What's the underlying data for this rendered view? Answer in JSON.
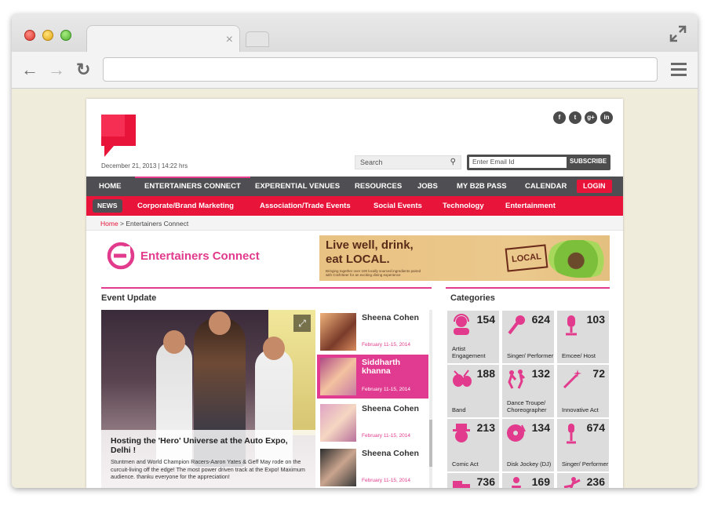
{
  "browser": {
    "tab_close": "×",
    "address_value": ""
  },
  "header": {
    "date": "December 21, 2013",
    "time": "14:22 hrs",
    "date_sep": "|",
    "social": [
      "f",
      "t",
      "g+",
      "in"
    ],
    "search_placeholder": "Search",
    "email_placeholder": "Enter Email Id",
    "subscribe_label": "SUBSCRIBE"
  },
  "main_nav": {
    "items": [
      "HOME",
      "ENTERTAINERS CONNECT",
      "EXPERENTIAL VENUES",
      "RESOURCES",
      "JOBS",
      "MY B2B PASS",
      "CALENDAR"
    ],
    "active": "ENTERTAINERS CONNECT",
    "login": "LOGIN"
  },
  "sub_nav": {
    "badge": "NEWS",
    "items": [
      "Corporate/Brand Marketing",
      "Association/Trade Events",
      "Social Events",
      "Technology",
      "Entertainment"
    ]
  },
  "breadcrumb": {
    "home": "Home",
    "sep": " > ",
    "current": "Entertainers Connect"
  },
  "page_title": "Entertainers Connect",
  "banner": {
    "line1": "Live well, drink,",
    "line2": "eat LOCAL.",
    "small": "Bringing together over 100 locally sourced ingredients paired with Craft Beer for an exciting dining experience",
    "badge": "LOCAL"
  },
  "event_update": {
    "title": "Event Update",
    "hero_title": "Hosting the 'Hero' Universe at the Auto Expo, Delhi !",
    "hero_text": "Stuntmen and World Champion Racers-Aaron Yates & Geff May rode on the curcuit-living off the edge! The most power driven track at the Expo! Maximum audience. thanku everyone for the appreciation!",
    "items": [
      {
        "name": "Sheena Cohen",
        "date": "February 11-15, 2014",
        "active": false
      },
      {
        "name": "Siddharth khanna",
        "date": "February 11-15, 2014",
        "active": true
      },
      {
        "name": "Sheena Cohen",
        "date": "February 11-15, 2014",
        "active": false
      },
      {
        "name": "Sheena Cohen",
        "date": "February 11-15, 2014",
        "active": false
      }
    ]
  },
  "categories": {
    "title": "Categories",
    "items": [
      {
        "count": "154",
        "label": "Artist Engagement",
        "icon": "headset-icon"
      },
      {
        "count": "624",
        "label": "Singer/ Performer",
        "icon": "microphone-icon"
      },
      {
        "count": "103",
        "label": "Emcee/ Host",
        "icon": "studio-mic-icon"
      },
      {
        "count": "188",
        "label": "Band",
        "icon": "drums-icon"
      },
      {
        "count": "132",
        "label": "Dance Troupe/ Choreographer",
        "icon": "dancers-icon"
      },
      {
        "count": "72",
        "label": "Innovative Act",
        "icon": "magic-wand-icon"
      },
      {
        "count": "213",
        "label": "Comic Act",
        "icon": "clown-icon"
      },
      {
        "count": "134",
        "label": "Disk Jockey (DJ)",
        "icon": "turntable-icon"
      },
      {
        "count": "674",
        "label": "Singer/ Performer",
        "icon": "stand-mic-icon"
      },
      {
        "count": "736",
        "label": "",
        "icon": "masks-icon"
      },
      {
        "count": "169",
        "label": "",
        "icon": "performer-icon"
      },
      {
        "count": "236",
        "label": "",
        "icon": "dancer-icon"
      }
    ]
  },
  "colors": {
    "accent_pink": "#e23a8c",
    "accent_red": "#e8143a",
    "nav_dark": "#4f4f53"
  }
}
